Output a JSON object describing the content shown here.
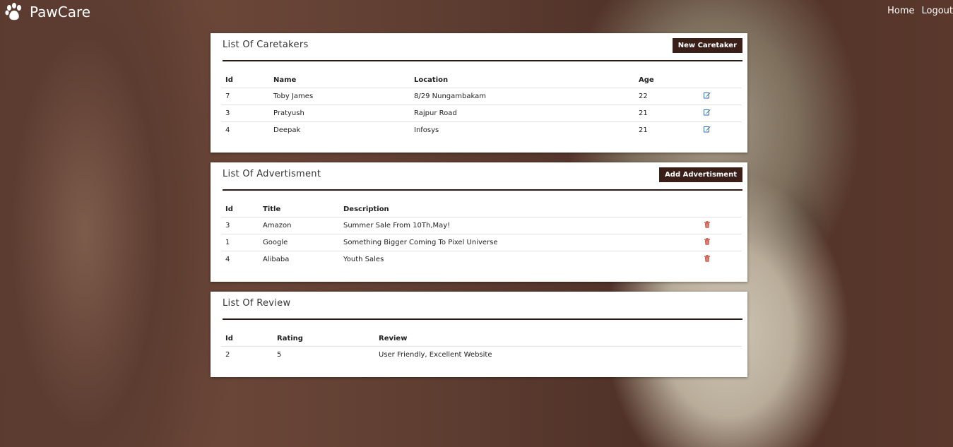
{
  "navbar": {
    "brand": "PawCare",
    "brand_icon": "paw-icon",
    "links": [
      "Home",
      "Logout"
    ]
  },
  "caretakers": {
    "title": "List Of Caretakers",
    "button": "New Caretaker",
    "columns": [
      "Id",
      "Name",
      "Location",
      "Age"
    ],
    "rows": [
      {
        "id": "7",
        "name": "Toby James",
        "location": "8/29 Nungambakam",
        "age": "22"
      },
      {
        "id": "3",
        "name": "Pratyush",
        "location": "Rajpur Road",
        "age": "21"
      },
      {
        "id": "4",
        "name": "Deepak",
        "location": "Infosys",
        "age": "21"
      }
    ],
    "row_action_icon": "edit-icon"
  },
  "advertisements": {
    "title": "List Of Advertisment",
    "button": "Add Advertisment",
    "columns": [
      "Id",
      "Title",
      "Description"
    ],
    "rows": [
      {
        "id": "3",
        "title": "Amazon",
        "description": "Summer Sale From 10Th,May!"
      },
      {
        "id": "1",
        "title": "Google",
        "description": "Something Bigger Coming To Pixel Universe"
      },
      {
        "id": "4",
        "title": "Alibaba",
        "description": "Youth Sales"
      }
    ],
    "row_action_icon": "trash-icon"
  },
  "reviews": {
    "title": "List Of Review",
    "columns": [
      "Id",
      "Rating",
      "Review"
    ],
    "rows": [
      {
        "id": "2",
        "rating": "5",
        "review": "User Friendly, Excellent Website"
      }
    ]
  },
  "colors": {
    "button_bg": "#3a1e18",
    "edit_icon": "#2f6fb0",
    "trash_icon": "#c0392b"
  }
}
